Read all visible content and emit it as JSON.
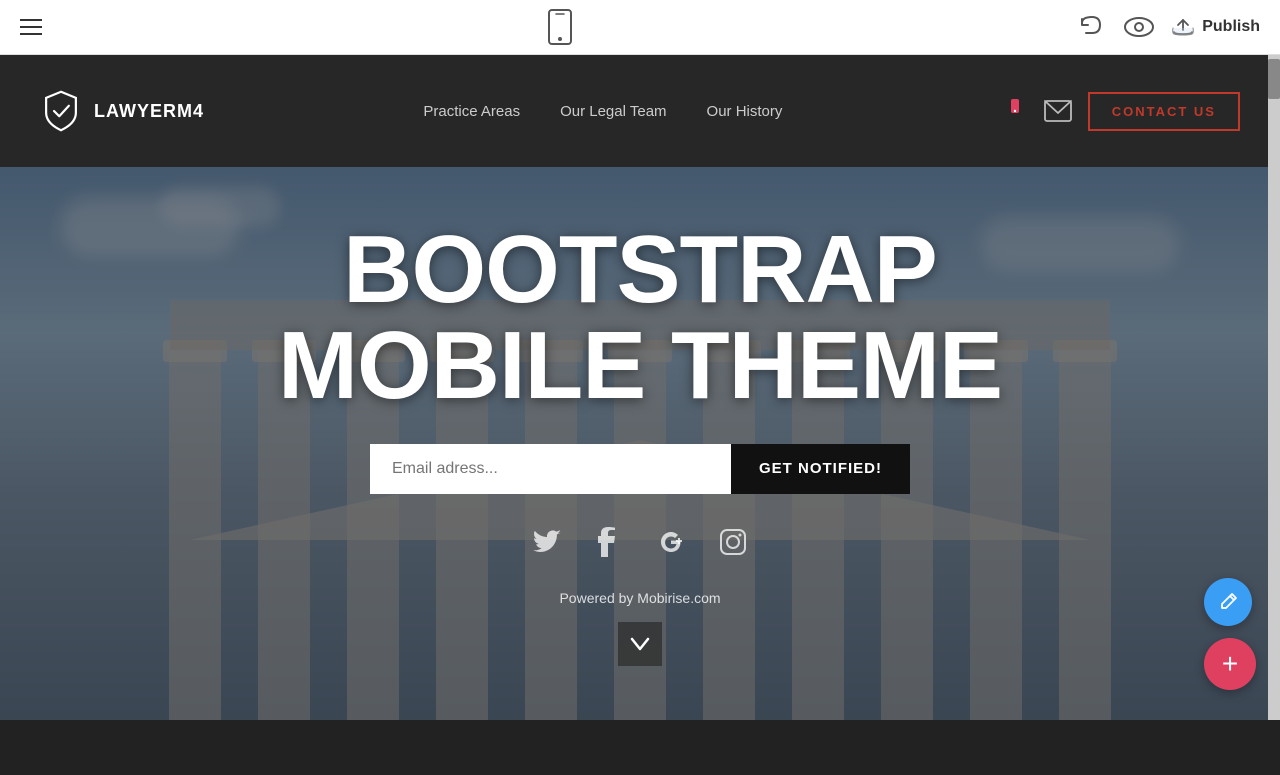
{
  "editor": {
    "publish_label": "Publish",
    "undo_label": "Undo",
    "preview_label": "Preview"
  },
  "navbar": {
    "brand_name": "LAWYERM4",
    "nav_links": [
      {
        "label": "Practice Areas"
      },
      {
        "label": "Our Legal Team"
      },
      {
        "label": "Our History"
      }
    ],
    "contact_btn_label": "CONTACT US"
  },
  "hero": {
    "title_line1": "BOOTSTRAP",
    "title_line2": "MOBILE THEME",
    "email_placeholder": "Email adress...",
    "notified_btn_label": "GET NOTIFIED!",
    "powered_text": "Powered by Mobirise.com"
  },
  "social": {
    "icons": [
      "twitter",
      "facebook",
      "google-plus",
      "instagram"
    ]
  },
  "fab": {
    "edit_icon": "✏",
    "add_icon": "+"
  }
}
